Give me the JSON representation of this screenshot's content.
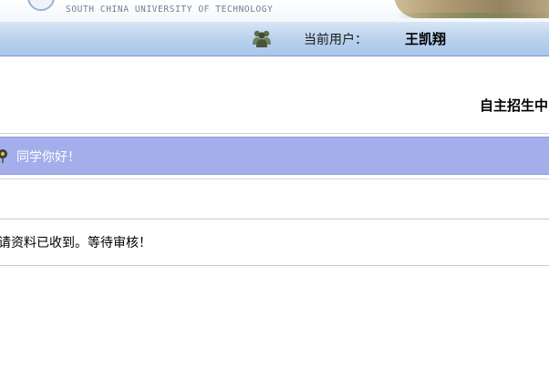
{
  "header": {
    "university_subtitle": "SOUTH CHINA UNIVERSITY OF TECHNOLOGY"
  },
  "userbar": {
    "current_user_label": "当前用户：",
    "current_user_name": "王凯翔",
    "icon": "users-icon"
  },
  "section": {
    "title": "自主招生中"
  },
  "greeting": {
    "icon": "sunflower-icon",
    "text": "同学你好！"
  },
  "message": {
    "text": "请资料已收到。等待审核！"
  },
  "colors": {
    "userbar_bg": "#bcd3ee",
    "greeting_bg": "#a3aeea",
    "greeting_text": "#ffffff"
  }
}
